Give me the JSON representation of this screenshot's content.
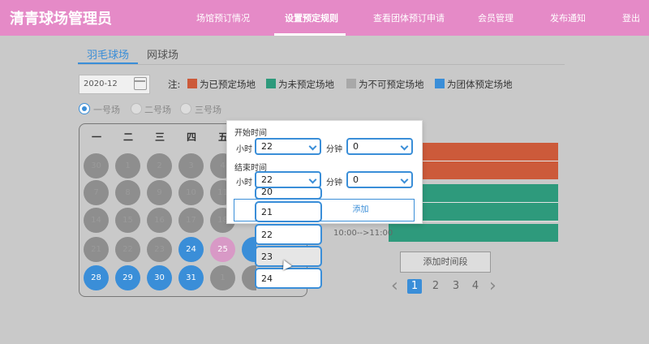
{
  "header": {
    "brand": "清青球场管理员",
    "nav": [
      "场馆预订情况",
      "设置预定规则",
      "查看团体预订申请",
      "会员管理",
      "发布通知",
      "登出"
    ]
  },
  "subtabs": [
    "羽毛球场",
    "网球场"
  ],
  "date": {
    "value": "2020-12"
  },
  "legend": {
    "prefix": "注:",
    "items": [
      {
        "label": "为已预定场地",
        "color": "#cc5a3a"
      },
      {
        "label": "为未预定场地",
        "color": "#2e9a7c"
      },
      {
        "label": "为不可预定场地",
        "color": "#a8a8a8"
      },
      {
        "label": "为团体预定场地",
        "color": "#3a8ed8"
      }
    ]
  },
  "courts": [
    "一号场",
    "二号场",
    "三号场"
  ],
  "calendar": {
    "weekdays": [
      "一",
      "二",
      "三",
      "四",
      "五"
    ],
    "days": [
      [
        "30",
        "1",
        "2",
        "3",
        "4"
      ],
      [
        "7",
        "8",
        "9",
        "10",
        "11"
      ],
      [
        "14",
        "15",
        "16",
        "17",
        "18"
      ],
      [
        "21",
        "22",
        "23",
        "24",
        "25"
      ],
      [
        "28",
        "29",
        "30",
        "31",
        "1"
      ]
    ]
  },
  "slots": {
    "visible_label": "10:00-->11:00",
    "add_button": "添加时间段"
  },
  "pagination": {
    "pages": [
      "1",
      "2",
      "3",
      "4"
    ],
    "current": "1"
  },
  "dialog": {
    "start_title": "开始时间",
    "end_title": "结束时间",
    "hour_label": "小时",
    "minute_label": "分钟",
    "start_hour": "22",
    "start_minute": "0",
    "end_hour": "22",
    "end_minute": "0",
    "confirm_label_partial": "添加"
  },
  "hour_dropdown": {
    "options": [
      "20",
      "21",
      "22",
      "23",
      "24"
    ],
    "hovered": "23"
  }
}
